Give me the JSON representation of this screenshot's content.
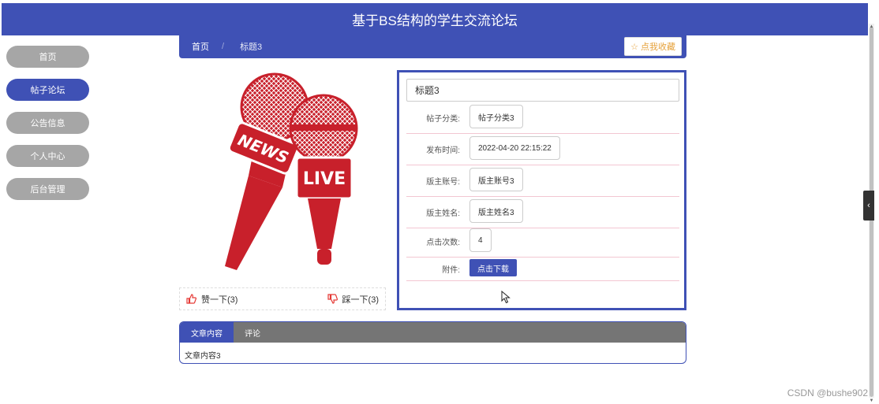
{
  "header": {
    "title": "基于BS结构的学生交流论坛"
  },
  "menu": {
    "items": [
      {
        "label": "首页",
        "active": false
      },
      {
        "label": "帖子论坛",
        "active": true
      },
      {
        "label": "公告信息",
        "active": false
      },
      {
        "label": "个人中心",
        "active": false
      },
      {
        "label": "后台管理",
        "active": false
      }
    ]
  },
  "breadcrumb": {
    "home": "首页",
    "separator": "/",
    "current": "标题3"
  },
  "favorite": {
    "icon": "star-icon",
    "label": "点我收藏"
  },
  "image": {
    "news_text": "NEWS",
    "live_text": "LIVE",
    "color": "#c8202b"
  },
  "votes": {
    "like": {
      "icon": "thumbs-up-icon",
      "label": "赞一下(3)"
    },
    "dislike": {
      "icon": "thumbs-down-icon",
      "label": "踩一下(3)"
    }
  },
  "post": {
    "title": "标题3",
    "fields": [
      {
        "label": "帖子分类:",
        "value": "帖子分类3"
      },
      {
        "label": "发布时间:",
        "value": "2022-04-20 22:15:22"
      },
      {
        "label": "版主账号:",
        "value": "版主账号3"
      },
      {
        "label": "版主姓名:",
        "value": "版主姓名3"
      },
      {
        "label": "点击次数:",
        "value": "4"
      }
    ],
    "attachment": {
      "label": "附件:",
      "button": "点击下载"
    }
  },
  "tabs": {
    "items": [
      "文章内容",
      "评论"
    ],
    "content": "文章内容3"
  },
  "watermark": "CSDN @bushe902",
  "colors": {
    "primary": "#3f51b5",
    "menu_inactive": "#a6a6a6",
    "tab_bar": "#757575",
    "accent": "#e6a23c"
  }
}
